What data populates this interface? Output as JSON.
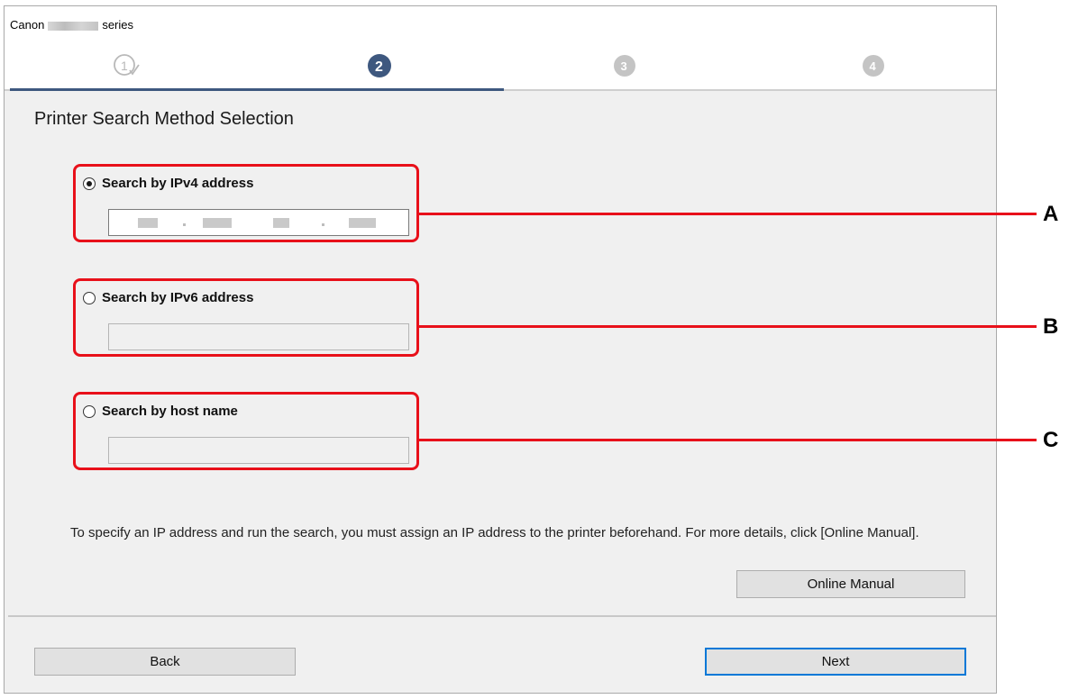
{
  "window": {
    "title_prefix": "Canon",
    "title_suffix": "series"
  },
  "steps": [
    {
      "label": "1",
      "state": "done"
    },
    {
      "label": "2",
      "state": "current"
    },
    {
      "label": "3",
      "state": "pending"
    },
    {
      "label": "4",
      "state": "pending"
    }
  ],
  "page_title": "Printer Search Method Selection",
  "options": [
    {
      "label": "Search by IPv4 address",
      "selected": true,
      "callout": "A"
    },
    {
      "label": "Search by IPv6 address",
      "selected": false,
      "callout": "B"
    },
    {
      "label": "Search by host name",
      "selected": false,
      "callout": "C"
    }
  ],
  "info_text": "To specify an IP address and run the search, you must assign an IP address to the printer beforehand. For more details, click [Online Manual].",
  "buttons": {
    "online_manual": "Online Manual",
    "back": "Back",
    "next": "Next"
  },
  "colors": {
    "annotation_red": "#e8101a",
    "active_step": "#3e587f",
    "default_button_border": "#0078d7"
  }
}
